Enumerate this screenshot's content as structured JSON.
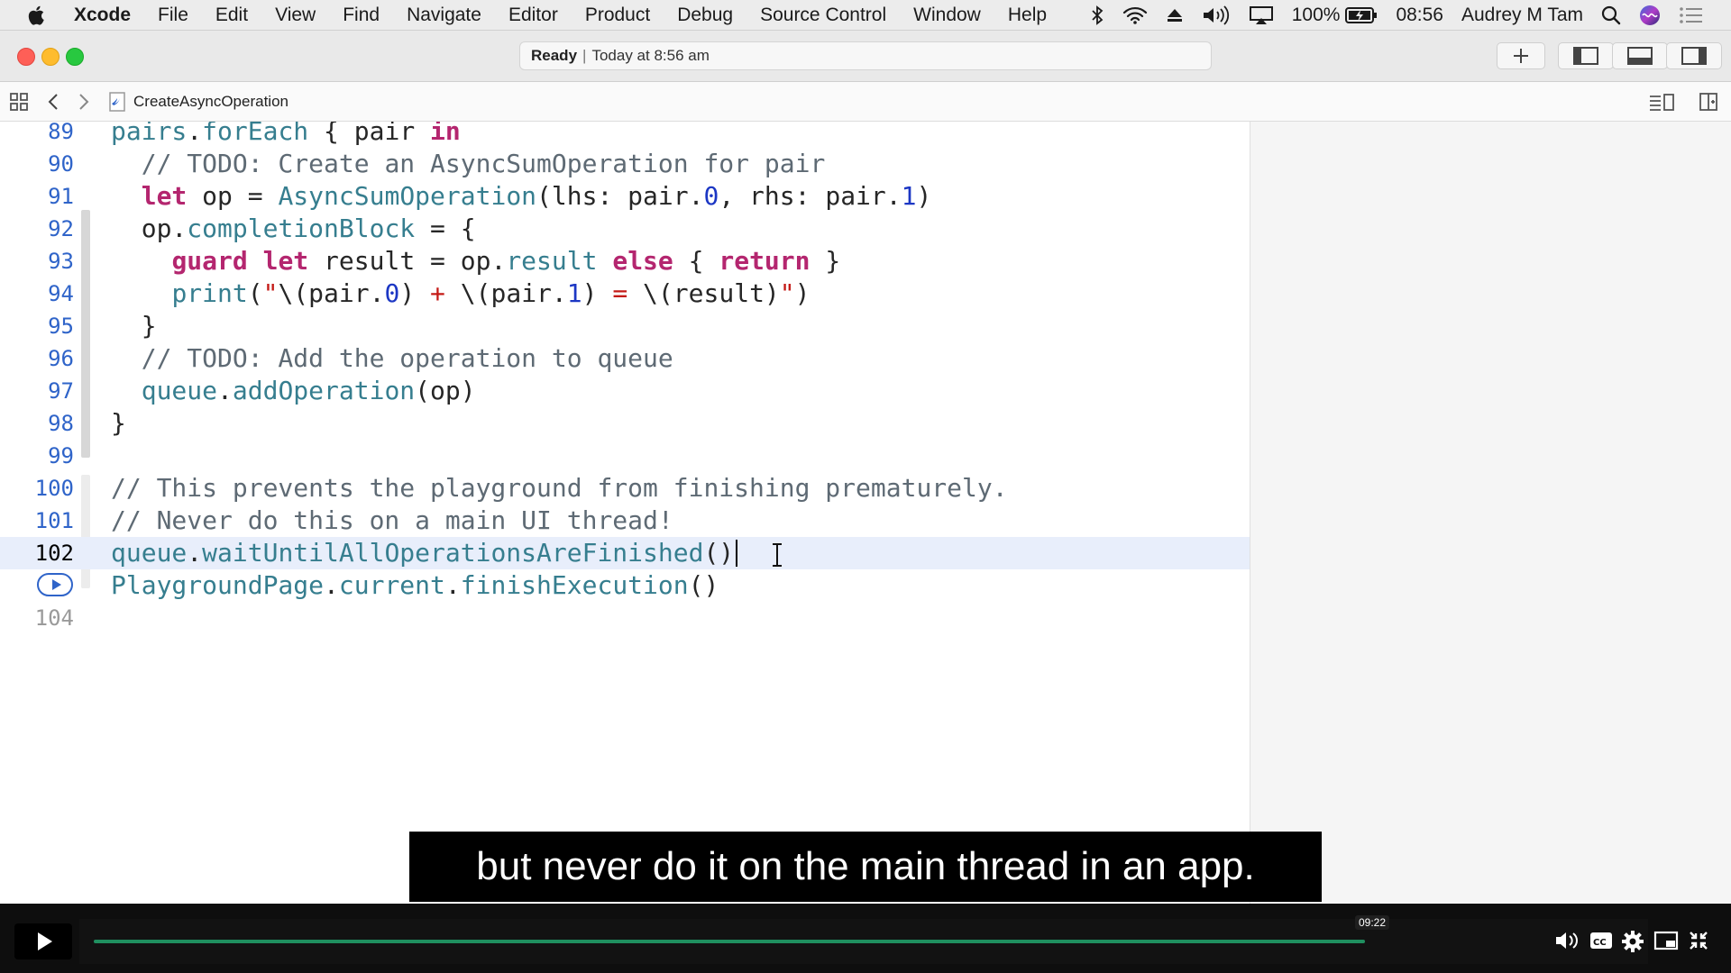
{
  "menubar": {
    "app_name": "Xcode",
    "items": [
      "File",
      "Edit",
      "View",
      "Find",
      "Navigate",
      "Editor",
      "Product",
      "Debug",
      "Source Control",
      "Window",
      "Help"
    ],
    "battery": "100%",
    "time": "08:56",
    "user": "Audrey M Tam"
  },
  "toolbar": {
    "status_bold": "Ready",
    "status_separator": "|",
    "status_detail": "Today at 8:56 am"
  },
  "jumpbar": {
    "file_name": "CreateAsyncOperation"
  },
  "editor": {
    "lines": [
      {
        "num": "89",
        "segs": [
          {
            "c": "prop",
            "t": "pairs"
          },
          {
            "c": "",
            "t": "."
          },
          {
            "c": "prop",
            "t": "forEach"
          },
          {
            "c": "",
            "t": " { pair "
          },
          {
            "c": "kw",
            "t": "in"
          }
        ]
      },
      {
        "num": "90",
        "segs": [
          {
            "c": "",
            "t": "  "
          },
          {
            "c": "cm",
            "t": "// TODO: Create an AsyncSumOperation for pair"
          }
        ]
      },
      {
        "num": "91",
        "segs": [
          {
            "c": "",
            "t": "  "
          },
          {
            "c": "kw",
            "t": "let"
          },
          {
            "c": "",
            "t": " op = "
          },
          {
            "c": "prop",
            "t": "AsyncSumOperation"
          },
          {
            "c": "",
            "t": "(lhs: pair."
          },
          {
            "c": "num",
            "t": "0"
          },
          {
            "c": "",
            "t": ", rhs: pair."
          },
          {
            "c": "num",
            "t": "1"
          },
          {
            "c": "",
            "t": ")"
          }
        ]
      },
      {
        "num": "92",
        "segs": [
          {
            "c": "",
            "t": "  op."
          },
          {
            "c": "prop",
            "t": "completionBlock"
          },
          {
            "c": "",
            "t": " = {"
          }
        ]
      },
      {
        "num": "93",
        "segs": [
          {
            "c": "",
            "t": "    "
          },
          {
            "c": "kw",
            "t": "guard"
          },
          {
            "c": "",
            "t": " "
          },
          {
            "c": "kw",
            "t": "let"
          },
          {
            "c": "",
            "t": " result = op."
          },
          {
            "c": "prop",
            "t": "result"
          },
          {
            "c": "",
            "t": " "
          },
          {
            "c": "kw",
            "t": "else"
          },
          {
            "c": "",
            "t": " { "
          },
          {
            "c": "kw",
            "t": "return"
          },
          {
            "c": "",
            "t": " }"
          }
        ]
      },
      {
        "num": "94",
        "segs": [
          {
            "c": "",
            "t": "    "
          },
          {
            "c": "prop",
            "t": "print"
          },
          {
            "c": "",
            "t": "("
          },
          {
            "c": "str",
            "t": "\""
          },
          {
            "c": "",
            "t": "\\(pair."
          },
          {
            "c": "num",
            "t": "0"
          },
          {
            "c": "",
            "t": ") "
          },
          {
            "c": "str",
            "t": "+"
          },
          {
            "c": "",
            "t": " \\(pair."
          },
          {
            "c": "num",
            "t": "1"
          },
          {
            "c": "",
            "t": ") "
          },
          {
            "c": "str",
            "t": "="
          },
          {
            "c": "",
            "t": " \\(result)"
          },
          {
            "c": "str",
            "t": "\""
          },
          {
            "c": "",
            "t": ")"
          }
        ]
      },
      {
        "num": "95",
        "segs": [
          {
            "c": "",
            "t": "  }"
          }
        ]
      },
      {
        "num": "96",
        "segs": [
          {
            "c": "",
            "t": "  "
          },
          {
            "c": "cm",
            "t": "// TODO: Add the operation to queue"
          }
        ]
      },
      {
        "num": "97",
        "segs": [
          {
            "c": "",
            "t": "  "
          },
          {
            "c": "prop",
            "t": "queue"
          },
          {
            "c": "",
            "t": "."
          },
          {
            "c": "prop",
            "t": "addOperation"
          },
          {
            "c": "",
            "t": "(op)"
          }
        ]
      },
      {
        "num": "98",
        "segs": [
          {
            "c": "",
            "t": "}"
          }
        ]
      },
      {
        "num": "99",
        "segs": []
      },
      {
        "num": "100",
        "segs": [
          {
            "c": "cm",
            "t": "// This prevents the playground from finishing prematurely."
          }
        ]
      },
      {
        "num": "101",
        "segs": [
          {
            "c": "cm",
            "t": "// Never do this on a main UI thread!"
          }
        ]
      },
      {
        "num": "102",
        "current": true,
        "segs": [
          {
            "c": "prop",
            "t": "queue"
          },
          {
            "c": "",
            "t": "."
          },
          {
            "c": "prop",
            "t": "waitUntilAllOperationsAreFinished"
          },
          {
            "c": "",
            "t": "()"
          }
        ]
      },
      {
        "num": "",
        "run": true,
        "segs": [
          {
            "c": "prop",
            "t": "PlaygroundPage"
          },
          {
            "c": "",
            "t": "."
          },
          {
            "c": "prop",
            "t": "current"
          },
          {
            "c": "",
            "t": "."
          },
          {
            "c": "prop",
            "t": "finishExecution"
          },
          {
            "c": "",
            "t": "()"
          }
        ]
      },
      {
        "num": "104",
        "dim": true,
        "segs": []
      }
    ]
  },
  "subtitle": {
    "text": "but never do it on the main thread in an app."
  },
  "video": {
    "timestamp": "09:22",
    "progress_fraction": 1.0
  },
  "colors": {
    "keyword": "#b4266f",
    "comment": "#5e6a74",
    "identifier": "#367e8f",
    "number": "#1c37c4",
    "line_number": "#2f64c9",
    "progress": "#1f8f5f"
  }
}
